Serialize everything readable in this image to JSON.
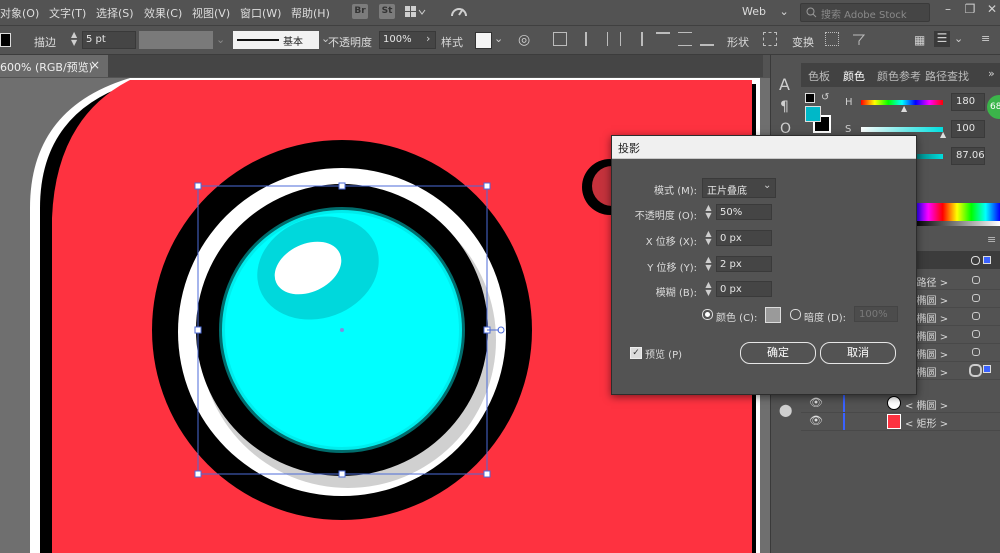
{
  "menu": {
    "items": [
      "对象(O)",
      "文字(T)",
      "选择(S)",
      "效果(C)",
      "视图(V)",
      "窗口(W)",
      "帮助(H)"
    ],
    "bridge_label": "Br",
    "stock_label": "St",
    "workspace": "Web",
    "search_placeholder": "搜索 Adobe Stock"
  },
  "control_bar": {
    "stroke_label": "描边",
    "stroke_value": "5 pt",
    "brush_label": "基本",
    "opacity_label": "不透明度",
    "opacity_value": "100%",
    "style_label": "样式",
    "shape_label": "形状",
    "transform_label": "变换"
  },
  "document": {
    "tab_title": "600% (RGB/预览)",
    "close_glyph": "×"
  },
  "color_panel": {
    "tabs": [
      "色板",
      "颜色",
      "颜色参考",
      "路径查找"
    ],
    "h_label": "H",
    "h_value": "180",
    "s_label": "S",
    "s_value": "100",
    "b_value": "87.06",
    "badge": "68"
  },
  "layers": {
    "rows": [
      "路径",
      "椭圆",
      "椭圆",
      "椭圆",
      "椭圆",
      "椭圆",
      "椭圆",
      "矩形"
    ]
  },
  "dialog": {
    "title": "投影",
    "mode_label": "模式 (M):",
    "mode_value": "正片叠底",
    "opacity_label": "不透明度 (O):",
    "opacity_value": "50%",
    "x_label": "X 位移 (X):",
    "x_value": "0 px",
    "y_label": "Y 位移 (Y):",
    "y_value": "2 px",
    "blur_label": "模糊 (B):",
    "blur_value": "0 px",
    "color_label": "颜色 (C):",
    "darkness_label": "暗度 (D):",
    "darkness_value": "100%",
    "preview_label": "预览 (P)",
    "ok_label": "确定",
    "cancel_label": "取消"
  },
  "colors": {
    "camera_red": "#fe3240",
    "lens_cyan": "#00ffff",
    "lens_shade": "#00d8dc",
    "accent_green": "#3bb54a"
  }
}
